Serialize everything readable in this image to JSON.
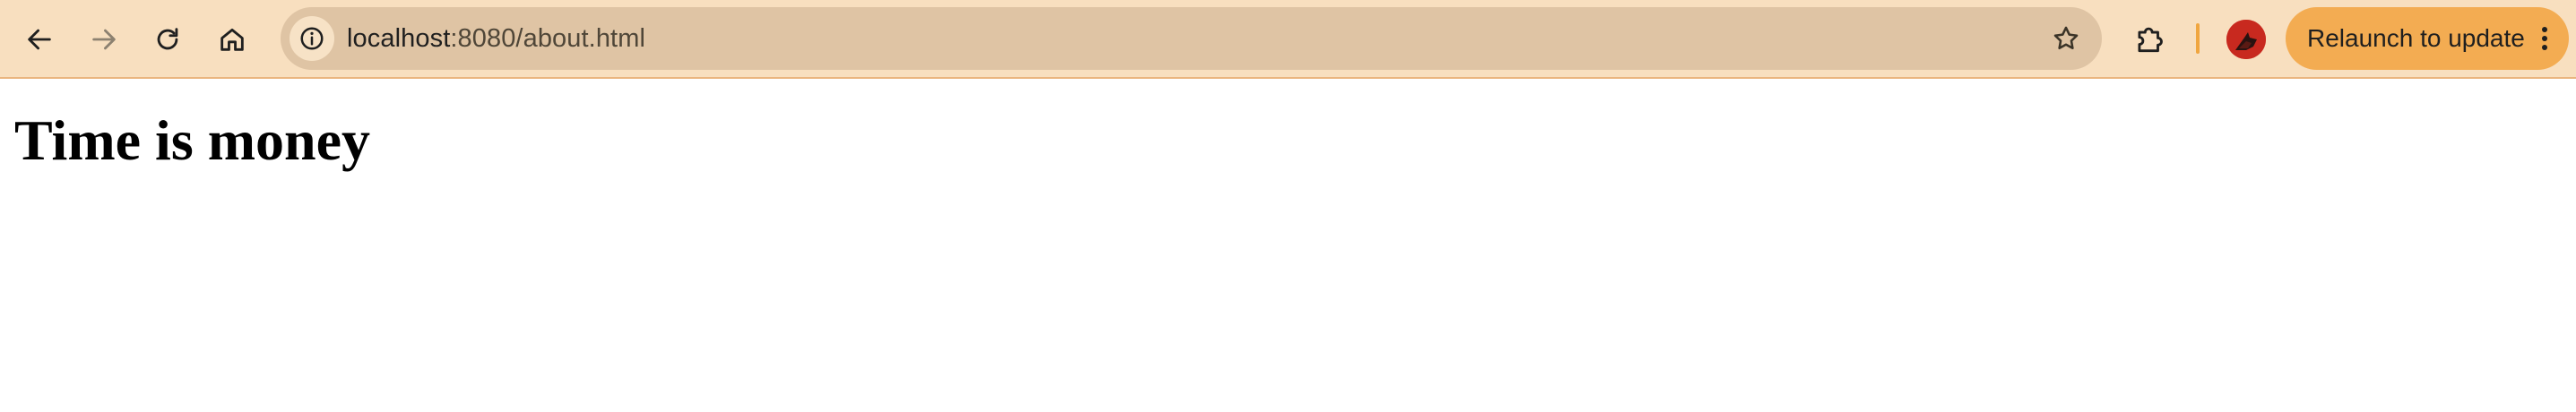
{
  "browser": {
    "toolbar": {
      "back_icon": "arrow-left-icon",
      "forward_icon": "arrow-right-icon",
      "reload_icon": "reload-icon",
      "home_icon": "home-icon"
    },
    "address_bar": {
      "info_icon": "info-icon",
      "url_host": "localhost",
      "url_rest": ":8080/about.html",
      "bookmark_icon": "star-icon"
    },
    "extensions_icon": "puzzle-piece-icon",
    "profile_icon": "avatar",
    "relaunch_button": {
      "label": "Relaunch to update",
      "menu_icon": "more-vertical-icon"
    },
    "colors": {
      "toolbar_background": "#f8dfbf",
      "omnibox_background": "#dfc4a4",
      "relaunch_background": "#f3ac52",
      "divider": "#f0a640",
      "avatar_background": "#c8291f"
    }
  },
  "page": {
    "heading": "Time is money"
  }
}
